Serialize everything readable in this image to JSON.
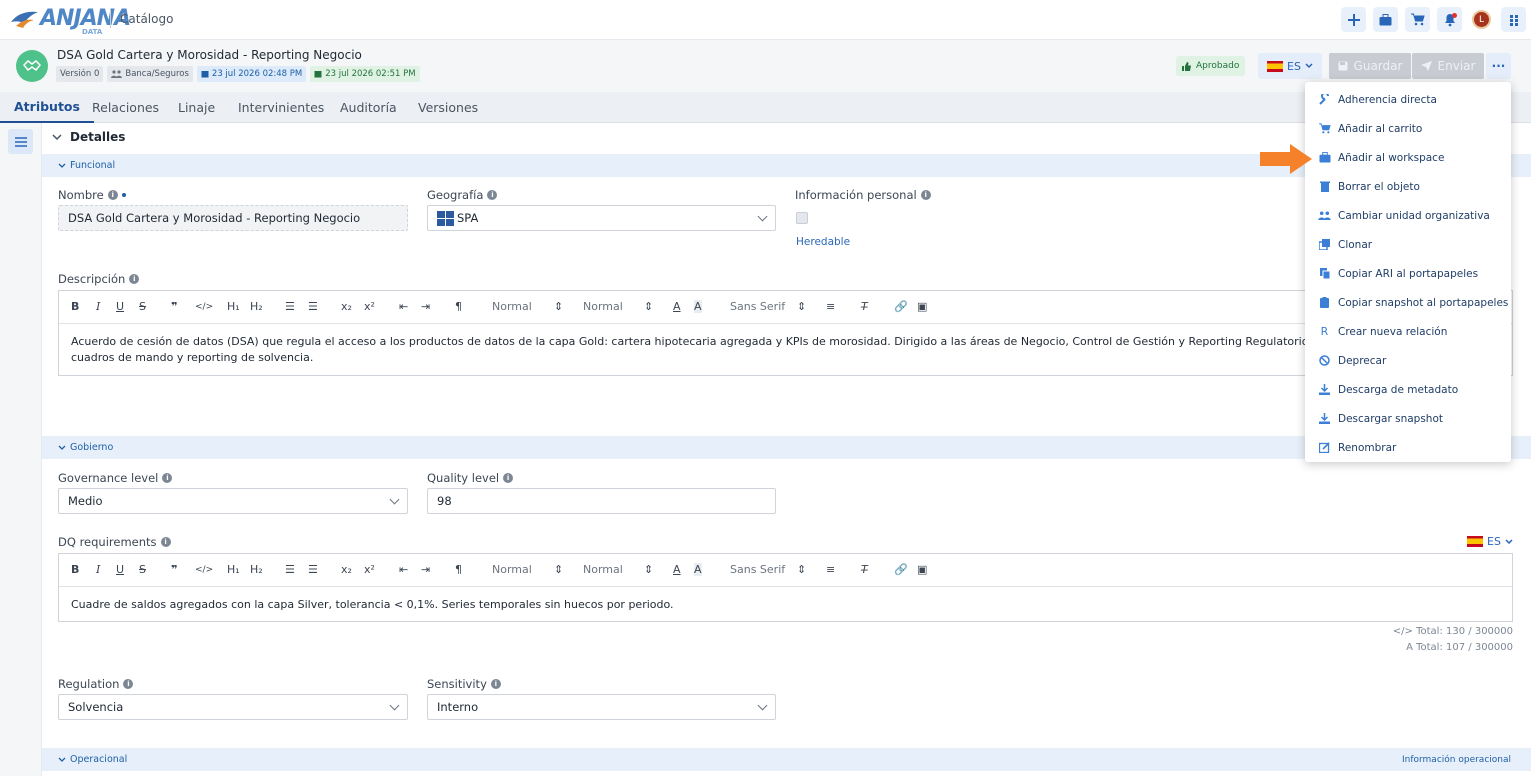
{
  "topbar": {
    "logo_text": "ANJANA",
    "logo_sub": "DATA",
    "catalog": "Catálogo",
    "avatar_initial": "L",
    "icons": [
      "plus-icon",
      "briefcase-icon",
      "cart-icon",
      "bell-icon",
      "avatar",
      "apps-icon"
    ]
  },
  "header": {
    "title": "DSA Gold Cartera y Morosidad - Reporting Negocio",
    "version": "Versión 0",
    "org": "Banca/Seguros",
    "date_created": "23 jul 2026 02:48 PM",
    "date_updated": "23 jul 2026 02:51 PM",
    "status": "Aprobado",
    "lang": "ES",
    "save": "Guardar",
    "send": "Enviar",
    "more": "···"
  },
  "tabs": [
    "Atributos",
    "Relaciones",
    "Linaje",
    "Intervinientes",
    "Auditoría",
    "Versiones"
  ],
  "details": {
    "title": "Detalles",
    "sections": {
      "funcional": "Funcional",
      "gobierno": "Gobierno",
      "operacional": "Operacional",
      "operacional_right": "Información operacional"
    },
    "fields": {
      "nombre_label": "Nombre",
      "nombre_value": "DSA Gold Cartera y Morosidad - Reporting Negocio",
      "geografia_label": "Geografía",
      "geografia_value": "SPA",
      "info_personal_label": "Información personal",
      "heredable": "Heredable",
      "descripcion_label": "Descripción",
      "descripcion_value": "Acuerdo de cesión de datos (DSA) que regula el acceso a los productos de datos de la capa Gold: cartera hipotecaria agregada y KPIs de morosidad. Dirigido a las áreas de Negocio, Control de Gestión y Reporting Regulatorio. Datos agregados sin",
      "descripcion_value2": "cuadros de mando y reporting de solvencia.",
      "governance_label": "Governance level",
      "governance_value": "Medio",
      "quality_label": "Quality level",
      "quality_value": "98",
      "dq_label": "DQ requirements",
      "dq_lang": "ES",
      "dq_value": "Cuadre de saldos agregados con la capa Silver, tolerancia < 0,1%. Series temporales sin huecos por periodo.",
      "dq_total_html": "Total: 130 / 300000",
      "dq_total_text": "Total: 107 / 300000",
      "regulation_label": "Regulation",
      "regulation_value": "Solvencia",
      "sensitivity_label": "Sensitivity",
      "sensitivity_value": "Interno"
    },
    "toolbar": {
      "normal1": "Normal",
      "normal2": "Normal",
      "font": "Sans Serif"
    }
  },
  "menu": {
    "items": [
      {
        "label": "Adherencia directa",
        "icon": "wrench-icon"
      },
      {
        "label": "Añadir al carrito",
        "icon": "cart-icon"
      },
      {
        "label": "Añadir al workspace",
        "icon": "briefcase-icon"
      },
      {
        "label": "Borrar el objeto",
        "icon": "trash-icon"
      },
      {
        "label": "Cambiar unidad organizativa",
        "icon": "users-icon"
      },
      {
        "label": "Clonar",
        "icon": "clone-icon"
      },
      {
        "label": "Copiar ARI al portapapeles",
        "icon": "copy-icon"
      },
      {
        "label": "Copiar snapshot al portapapeles",
        "icon": "clipboard-icon"
      },
      {
        "label": "Crear nueva relación",
        "icon": "relation-icon"
      },
      {
        "label": "Deprecar",
        "icon": "ban-icon"
      },
      {
        "label": "Descarga de metadato",
        "icon": "download-icon"
      },
      {
        "label": "Descargar snapshot",
        "icon": "download-icon"
      },
      {
        "label": "Renombrar",
        "icon": "edit-icon"
      }
    ]
  },
  "colors": {
    "accent": "#1f4f94",
    "arrow": "#f5822a",
    "menu_icon": "#3b7fd6"
  }
}
